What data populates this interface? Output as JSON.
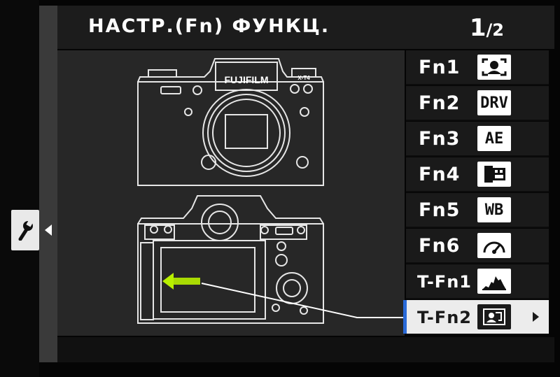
{
  "header": {
    "title": "НАСТР.(Fn) ФУНКЦ.",
    "page_current": "1",
    "page_total": "/2"
  },
  "sidebar": {
    "tab_icon": "wrench-icon"
  },
  "illustration": {
    "brand": "FUJIFILM",
    "model": "X-T4",
    "highlight_color": "#b8f000"
  },
  "menu": {
    "items": [
      {
        "label": "Fn1",
        "icon": "face-detect-icon",
        "icon_text": ""
      },
      {
        "label": "Fn2",
        "icon": "drive-icon",
        "icon_text": "DRV"
      },
      {
        "label": "Fn3",
        "icon": "ae-icon",
        "icon_text": "AE"
      },
      {
        "label": "Fn4",
        "icon": "film-simulation-icon",
        "icon_text": ""
      },
      {
        "label": "Fn5",
        "icon": "white-balance-icon",
        "icon_text": "WB"
      },
      {
        "label": "Fn6",
        "icon": "performance-gauge-icon",
        "icon_text": ""
      },
      {
        "label": "T-Fn1",
        "icon": "histogram-icon",
        "icon_text": ""
      },
      {
        "label": "T-Fn2",
        "icon": "live-view-icon",
        "icon_text": ""
      }
    ],
    "selected_index": 7
  },
  "colors": {
    "selection_accent": "#2a6ad8",
    "background": "#272727"
  }
}
